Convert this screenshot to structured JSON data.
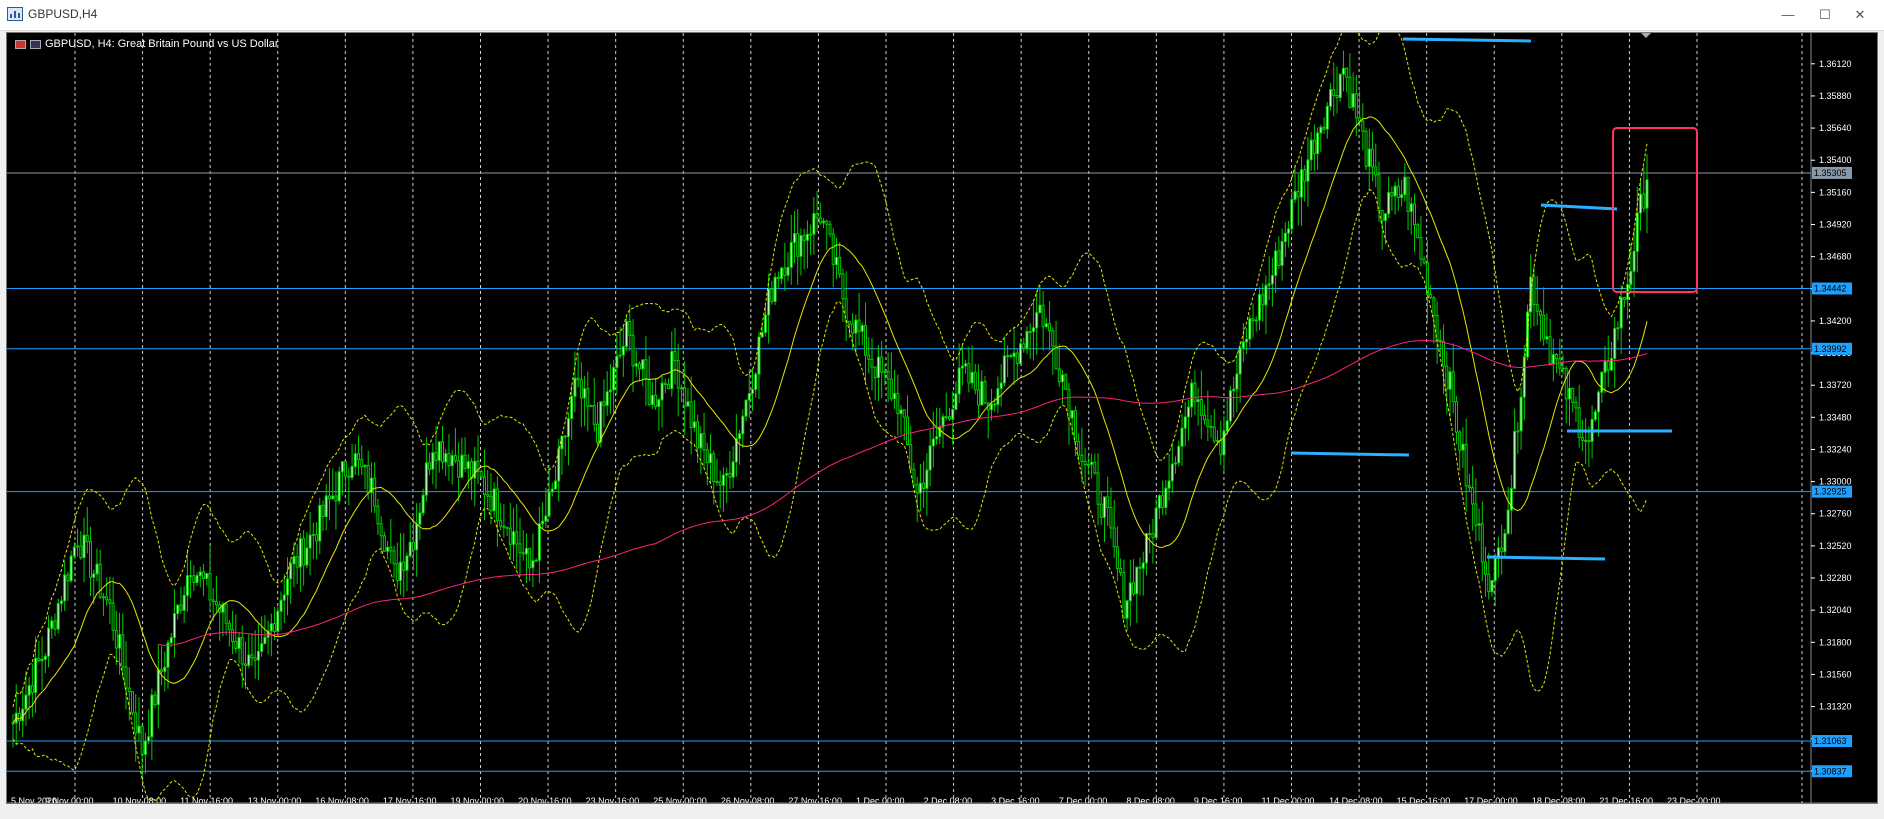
{
  "window": {
    "title": "GBPUSD,H4",
    "minimize": "—",
    "maximize": "☐",
    "close": "✕"
  },
  "chart": {
    "symbol_label": "GBPUSD, H4:  Great Britain Pound vs US Dollar",
    "colors": {
      "background": "#000000",
      "bull_candle": "#c8ffc8",
      "bear_candle": "#000000",
      "wick": "#00cc00",
      "moving_average": "#e6e600",
      "bollinger": "#e6e600",
      "long_ma": "#ff2080",
      "hlines": "#1ea0ff",
      "highlight_box": "#ff3366",
      "drawn_lines": "#2ab0ff",
      "grid": "#ffffff"
    }
  },
  "chart_data": {
    "type": "candlestick",
    "title": "GBPUSD, H4:  Great Britain Pound vs US Dollar",
    "ylim": [
      1.306,
      1.3635
    ],
    "y_ticks": [
      "1.36120",
      "1.35880",
      "1.35640",
      "1.35400",
      "1.35160",
      "1.34920",
      "1.34680",
      "1.34440",
      "1.34200",
      "1.33960",
      "1.33720",
      "1.33480",
      "1.33240",
      "1.33000",
      "1.32760",
      "1.32520",
      "1.32280",
      "1.32040",
      "1.31800",
      "1.31560",
      "1.31320",
      "1.31080",
      "1.30840"
    ],
    "x_ticks": [
      "5 Nov 2020",
      "9 Nov 00:00",
      "10 Nov 08:00",
      "11 Nov 16:00",
      "13 Nov 00:00",
      "16 Nov 08:00",
      "17 Nov 16:00",
      "19 Nov 00:00",
      "20 Nov 16:00",
      "23 Nov 16:00",
      "25 Nov 00:00",
      "26 Nov 08:00",
      "27 Nov 16:00",
      "1 Dec 00:00",
      "2 Dec 08:00",
      "3 Dec 16:00",
      "7 Dec 00:00",
      "8 Dec 08:00",
      "9 Dec 16:00",
      "11 Dec 00:00",
      "14 Dec 08:00",
      "15 Dec 16:00",
      "17 Dec 00:00",
      "18 Dec 08:00",
      "21 Dec 16:00",
      "23 Dec 00:00"
    ],
    "current_price": "1.35305",
    "price_levels": [
      "1.34442",
      "1.33992",
      "1.32925",
      "1.31063",
      "1.30837"
    ],
    "price_path": [
      [
        0,
        1.312
      ],
      [
        10,
        1.3175
      ],
      [
        20,
        1.326
      ],
      [
        30,
        1.3205
      ],
      [
        40,
        1.31
      ],
      [
        45,
        1.315
      ],
      [
        55,
        1.324
      ],
      [
        65,
        1.32
      ],
      [
        75,
        1.3155
      ],
      [
        85,
        1.323
      ],
      [
        95,
        1.327
      ],
      [
        105,
        1.332
      ],
      [
        112,
        1.329
      ],
      [
        118,
        1.323
      ],
      [
        124,
        1.326
      ],
      [
        130,
        1.333
      ],
      [
        136,
        1.332
      ],
      [
        145,
        1.33
      ],
      [
        153,
        1.327
      ],
      [
        160,
        1.3235
      ],
      [
        167,
        1.329
      ],
      [
        174,
        1.337
      ],
      [
        181,
        1.334
      ],
      [
        190,
        1.341
      ],
      [
        198,
        1.336
      ],
      [
        205,
        1.339
      ],
      [
        212,
        1.333
      ],
      [
        220,
        1.3295
      ],
      [
        228,
        1.337
      ],
      [
        236,
        1.3455
      ],
      [
        243,
        1.348
      ],
      [
        250,
        1.35
      ],
      [
        258,
        1.343
      ],
      [
        266,
        1.339
      ],
      [
        274,
        1.336
      ],
      [
        280,
        1.329
      ],
      [
        287,
        1.334
      ],
      [
        294,
        1.338
      ],
      [
        302,
        1.336
      ],
      [
        310,
        1.3395
      ],
      [
        318,
        1.343
      ],
      [
        325,
        1.338
      ],
      [
        331,
        1.332
      ],
      [
        338,
        1.328
      ],
      [
        344,
        1.321
      ],
      [
        351,
        1.325
      ],
      [
        358,
        1.331
      ],
      [
        366,
        1.337
      ],
      [
        374,
        1.333
      ],
      [
        382,
        1.341
      ],
      [
        390,
        1.3455
      ],
      [
        398,
        1.352
      ],
      [
        405,
        1.357
      ],
      [
        412,
        1.361
      ],
      [
        418,
        1.3555
      ],
      [
        424,
        1.35
      ],
      [
        431,
        1.352
      ],
      [
        438,
        1.345
      ],
      [
        445,
        1.337
      ],
      [
        451,
        1.329
      ],
      [
        458,
        1.322
      ],
      [
        464,
        1.33
      ],
      [
        470,
        1.345
      ],
      [
        476,
        1.34
      ],
      [
        482,
        1.336
      ],
      [
        488,
        1.333
      ],
      [
        494,
        1.339
      ],
      [
        500,
        1.345
      ],
      [
        506,
        1.353
      ]
    ],
    "moving_average_label": "",
    "series": []
  }
}
